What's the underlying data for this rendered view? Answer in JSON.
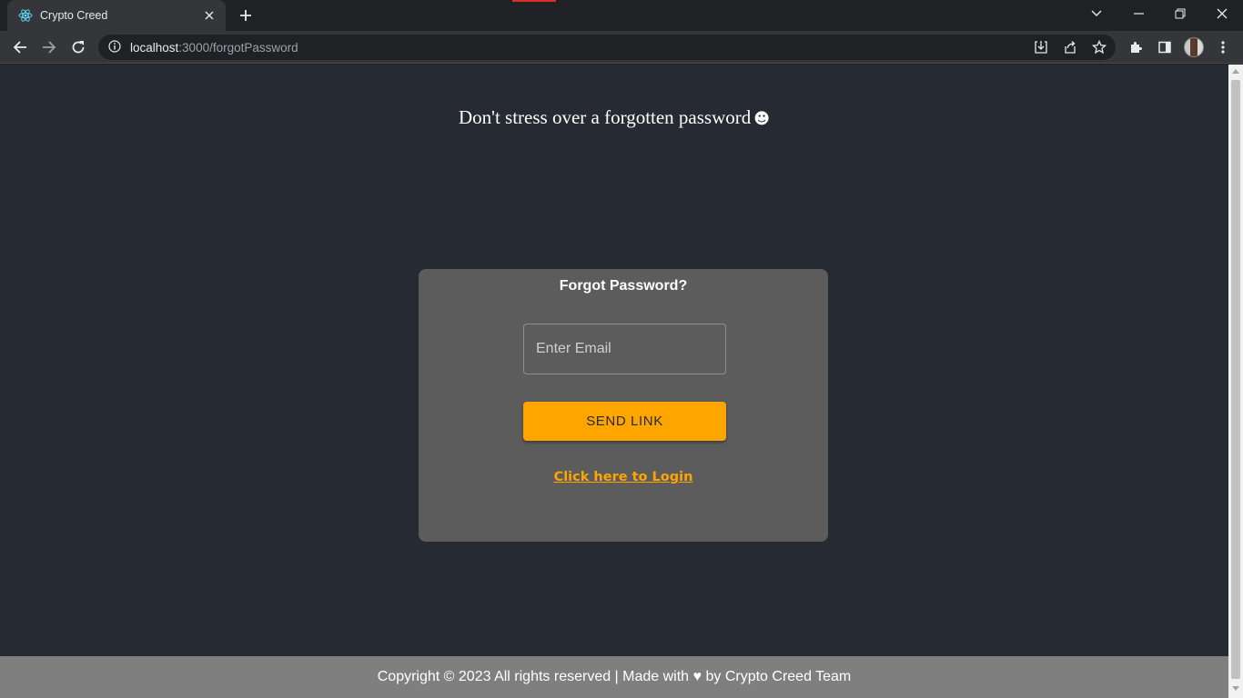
{
  "browser": {
    "tab_title": "Crypto Creed",
    "url_host": "localhost",
    "url_path": ":3000/forgotPassword"
  },
  "page": {
    "headline": "Don't stress over a forgotten password",
    "headline_emoji": "☻",
    "card": {
      "title": "Forgot Password?",
      "email_placeholder": "Enter Email",
      "send_button": "SEND LINK",
      "login_link": "Click here to Login"
    },
    "footer": "Copyright © 2023 All rights reserved | Made with ♥ by Crypto Creed Team"
  },
  "colors": {
    "accent": "#ffa500",
    "page_bg": "#262a33",
    "card_bg": "#5c5c5c",
    "footer_bg": "#7f7f7f"
  }
}
